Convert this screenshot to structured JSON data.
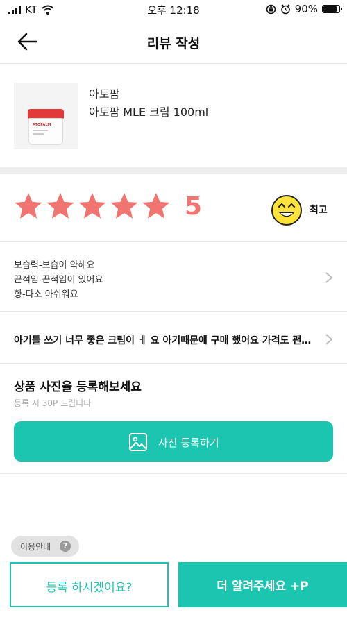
{
  "status_bar": {
    "carrier": "KT",
    "time": "오후 12:18",
    "battery": "90%",
    "icons": [
      "signal-icon",
      "wifi-icon",
      "rotation-lock-icon",
      "alarm-icon",
      "battery-icon"
    ]
  },
  "header": {
    "title": "리뷰 작성",
    "back_icon": "arrow-left-icon"
  },
  "product": {
    "brand": "아토팜",
    "name": "아토팜 MLE 크림 100ml",
    "image_label": "ATOPALM"
  },
  "rating": {
    "value": "5",
    "stars_filled": 5,
    "stars_total": 5,
    "word": "최고",
    "star_color": "#f07470",
    "emoji_color": "#ffe23a"
  },
  "attributes": [
    "보습력-보습이 약해요",
    "끈적임-끈적임이 있어요",
    "향-다소 아쉬워요"
  ],
  "review_text": "아기들 쓰기 너무 좋은 크림이 ㅔ 요 아기때문에 구매 했어요 가격도 괜찮아요",
  "photo": {
    "title": "상품 사진을 등록해보세요",
    "subtitle": "등록 시 30P 드립니다",
    "button_label": "사진 등록하기"
  },
  "footer": {
    "usage_guide": "이용안내",
    "help_glyph": "?",
    "register_label": "등록 하시겠어요?",
    "more_label": "더 알려주세요 +P",
    "accent_color": "#1cc5b0"
  }
}
